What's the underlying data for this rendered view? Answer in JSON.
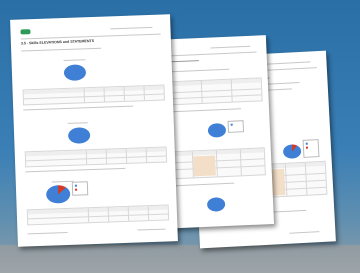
{
  "document_title": "3.5 - Skills ELEVATIONS and STATEMENTS",
  "colors": {
    "background": "#2a6fa6",
    "pie_blue": "#3f7fd6",
    "pie_red": "#d23a2a",
    "accent_green": "#2f9a57"
  },
  "icons": [
    "logo-icon"
  ]
}
